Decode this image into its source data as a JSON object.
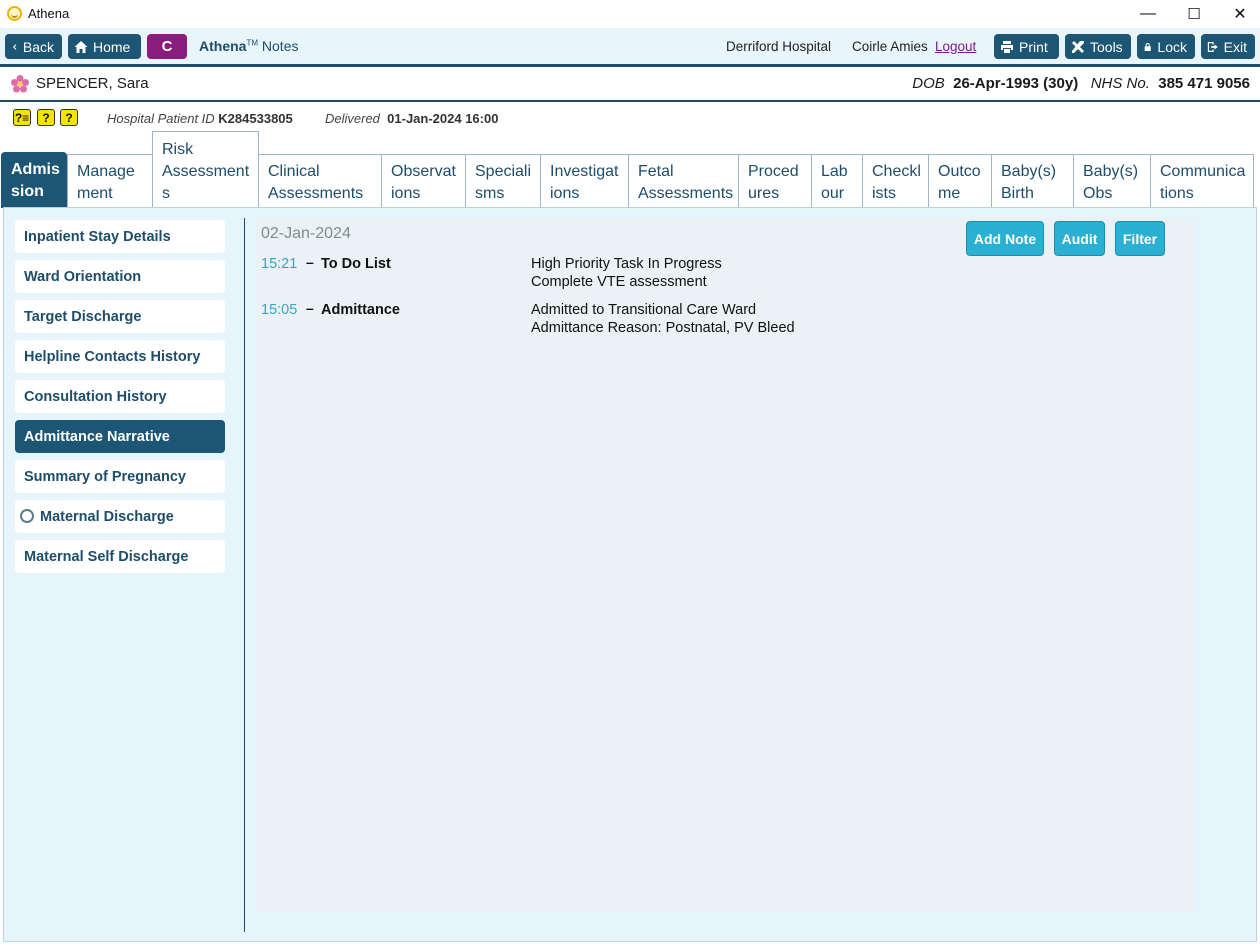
{
  "window": {
    "title": "Athena",
    "min": "—",
    "max": "☐",
    "close": "✕"
  },
  "toolbar": {
    "back": "Back",
    "home": "Home",
    "c_label": "C",
    "brand_bold": "Athena",
    "brand_tm": "TM",
    "brand_rest": " Notes",
    "hospital": "Derriford Hospital",
    "user": "Coirle Amies",
    "logout": "Logout",
    "print": "Print",
    "tools": "Tools",
    "lock": "Lock",
    "exit": "Exit"
  },
  "patient": {
    "name": "SPENCER, Sara",
    "dob_label": "DOB",
    "dob": "26-Apr-1993 (30y)",
    "nhs_label": "NHS No.",
    "nhs": "385 471 9056",
    "hpid_label": "Hospital Patient ID",
    "hpid": "K284533805",
    "delivered_label": "Delivered",
    "delivered": "01-Jan-2024 16:00",
    "alert_icons": [
      "?≡",
      "?",
      "?"
    ]
  },
  "tabs": [
    {
      "line1": "Admis",
      "line2": "sion"
    },
    {
      "line1": "Manage",
      "line2": "ment"
    },
    {
      "line1": "Risk",
      "line2": "Assessment",
      "line3": "s"
    },
    {
      "line1": "Clinical",
      "line2": "Assessments"
    },
    {
      "line1": "Observat",
      "line2": "ions"
    },
    {
      "line1": "Speciali",
      "line2": "sms"
    },
    {
      "line1": "Investigat",
      "line2": "ions"
    },
    {
      "line1": "Fetal",
      "line2": "Assessments"
    },
    {
      "line1": "Proced",
      "line2": "ures"
    },
    {
      "line1": "Lab",
      "line2": "our"
    },
    {
      "line1": "Checkl",
      "line2": "ists"
    },
    {
      "line1": "Outco",
      "line2": "me"
    },
    {
      "line1": "Baby(s)",
      "line2": "Birth"
    },
    {
      "line1": "Baby(s)",
      "line2": "Obs"
    },
    {
      "line1": "Communica",
      "line2": "tions"
    }
  ],
  "sidebar": [
    "Inpatient Stay Details",
    "Ward Orientation",
    "Target Discharge",
    "Helpline Contacts History",
    "Consultation History",
    "Admittance Narrative",
    "Summary of Pregnancy",
    "Maternal Discharge",
    "Maternal Self Discharge"
  ],
  "content": {
    "date": "02-Jan-2024",
    "actions": {
      "add_note": "Add Note",
      "audit": "Audit",
      "filter": "Filter"
    },
    "notes": [
      {
        "time": "15:21",
        "title": "To Do List",
        "lines": [
          "High Priority Task In Progress",
          "Complete VTE assessment"
        ]
      },
      {
        "time": "15:05",
        "title": "Admittance",
        "lines": [
          "Admitted to Transitional Care Ward",
          "Admittance Reason: Postnatal, PV Bleed"
        ]
      }
    ]
  },
  "colors": {
    "navy": "#1d5575",
    "accent_button": "#2ab0d2",
    "magenta": "#8b1c7e",
    "panel_bg": "#e6f5fc"
  }
}
